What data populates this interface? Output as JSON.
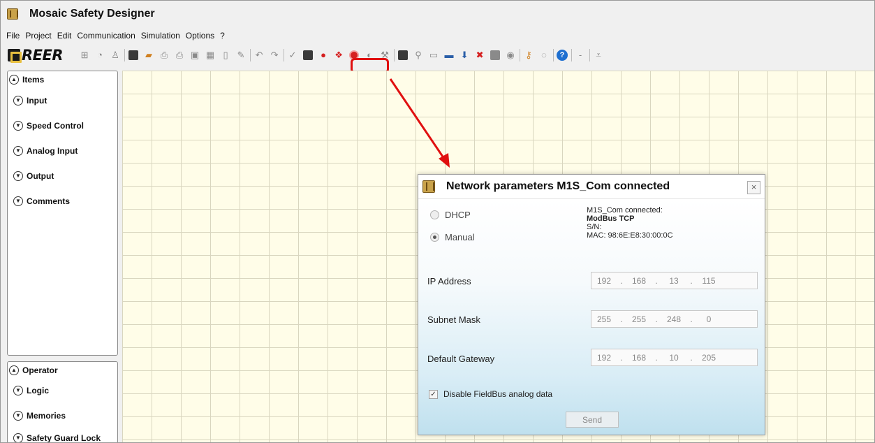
{
  "app": {
    "title": "Mosaic Safety Designer",
    "icon": "mosaic-app-icon"
  },
  "menu": [
    "File",
    "Project",
    "Edit",
    "Communication",
    "Simulation",
    "Options",
    "?"
  ],
  "toolbar": {
    "logo": "REER",
    "overflow": "-",
    "dropdown": "⩡"
  },
  "items_panel": {
    "header": "Items",
    "groups": [
      "Input",
      "Speed Control",
      "Analog Input",
      "Output",
      "Comments"
    ]
  },
  "operator_panel": {
    "header": "Operator",
    "groups": [
      "Logic",
      "Memories",
      "Safety Guard Lock"
    ]
  },
  "dialog": {
    "title": "Network parameters M1S_Com connected",
    "close": "×",
    "radio_dhcp": "DHCP",
    "radio_manual": "Manual",
    "selected": "Manual",
    "info": {
      "device": "M1S_Com connected:",
      "protocol": "ModBus TCP",
      "serial": "S/N:",
      "mac": "MAC: 98:6E:E8:30:00:0C"
    },
    "fields": [
      {
        "label": "IP Address",
        "octets": [
          "192",
          "168",
          "13",
          "115"
        ]
      },
      {
        "label": "Subnet Mask",
        "octets": [
          "255",
          "255",
          "248",
          "0"
        ]
      },
      {
        "label": "Default Gateway",
        "octets": [
          "192",
          "168",
          "10",
          "205"
        ]
      }
    ],
    "checkbox_label": "Disable FieldBus analog data",
    "checkbox_checked": true,
    "send_label": "Send"
  },
  "colors": {
    "highlight": "#e01010",
    "canvas": "#fffde8",
    "grid": "#d9d6bf"
  }
}
